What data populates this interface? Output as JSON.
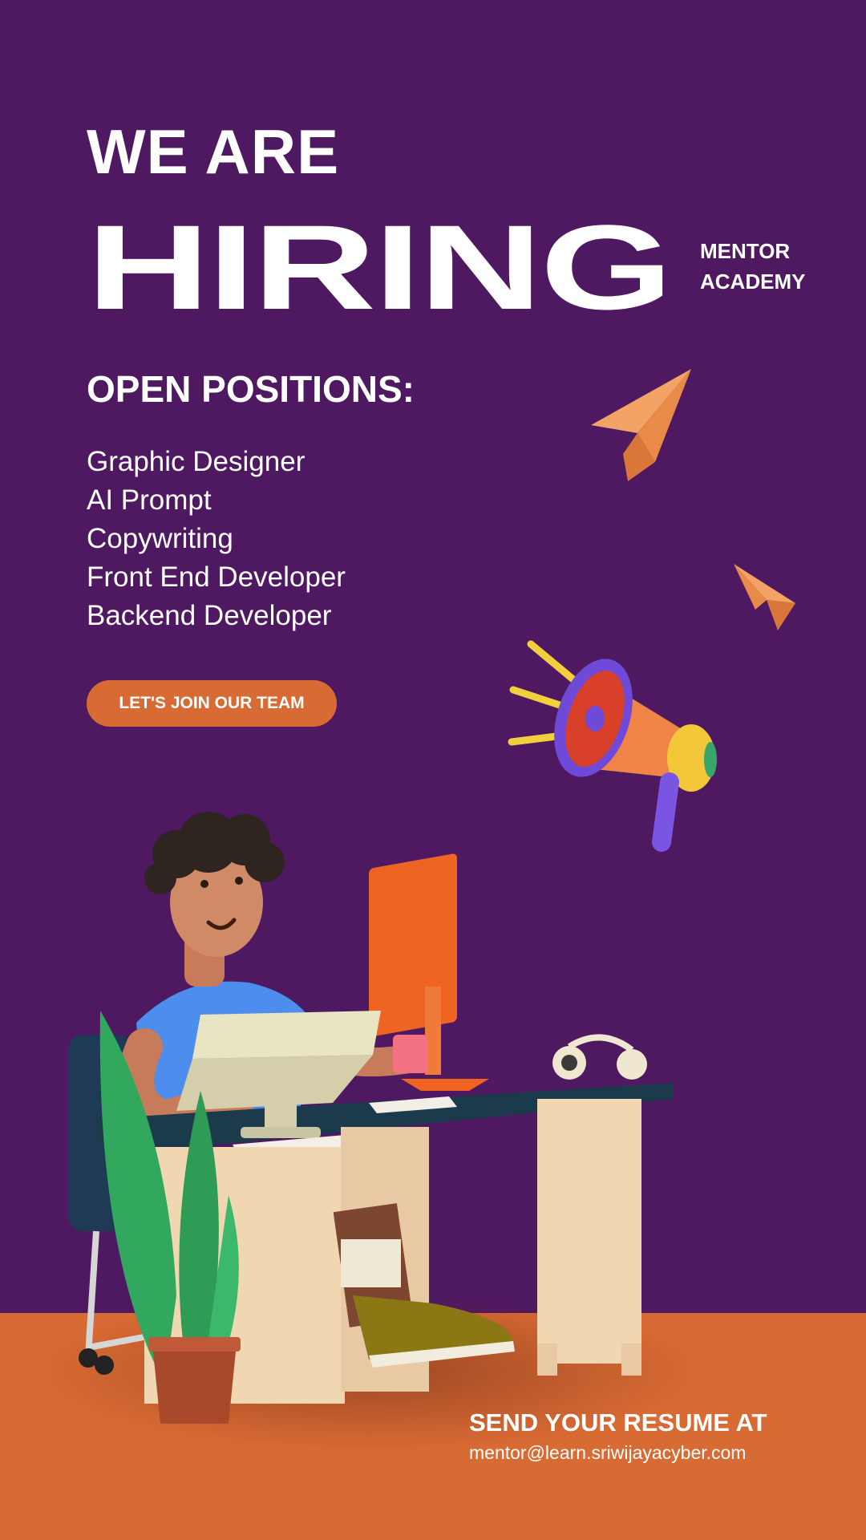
{
  "header": {
    "line1": "WE ARE",
    "line2": "HIRING",
    "brand_line1": "MENTOR",
    "brand_line2": "ACADEMY"
  },
  "positions": {
    "title": "OPEN POSITIONS:",
    "items": [
      "Graphic Designer",
      "AI Prompt",
      "Copywriting",
      "Front End Developer",
      "Backend Developer"
    ]
  },
  "cta": {
    "label": "LET'S JOIN OUR TEAM"
  },
  "footer": {
    "title": "SEND YOUR RESUME AT",
    "email": "mentor@learn.sriwijayacyber.com"
  },
  "colors": {
    "background": "#4e1961",
    "accent": "#d86a34",
    "text": "#ffffff"
  },
  "icons": [
    "paper-plane-icon",
    "megaphone-icon"
  ]
}
